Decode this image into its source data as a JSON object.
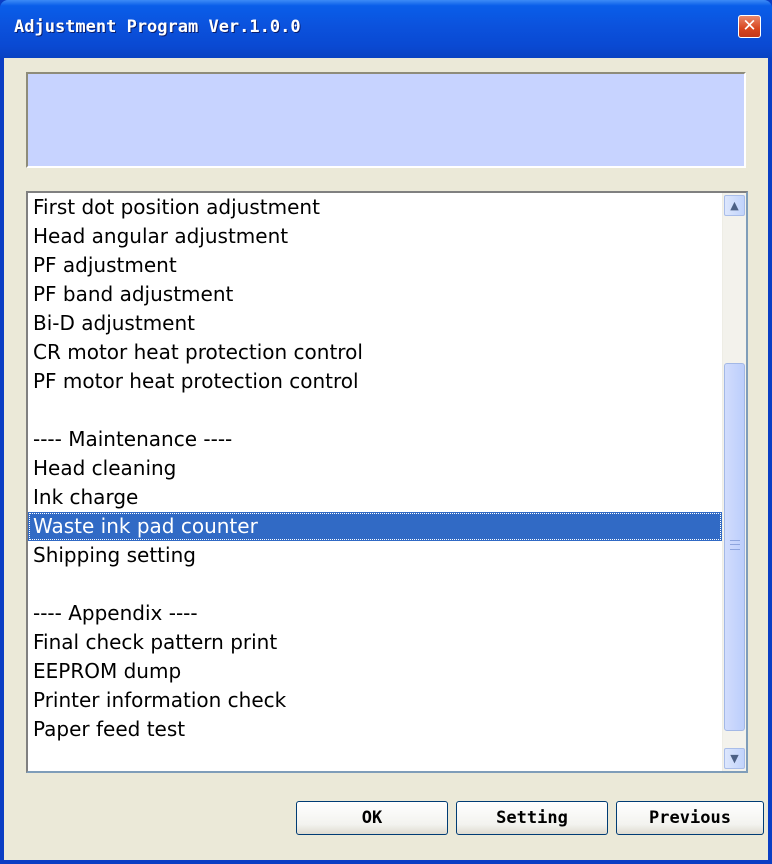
{
  "window": {
    "title": "Adjustment Program Ver.1.0.0",
    "close_glyph": "✕"
  },
  "list": {
    "items": [
      {
        "label": "First dot position adjustment",
        "selected": false
      },
      {
        "label": "Head angular adjustment",
        "selected": false
      },
      {
        "label": "PF adjustment",
        "selected": false
      },
      {
        "label": "PF band adjustment",
        "selected": false
      },
      {
        "label": "Bi-D adjustment",
        "selected": false
      },
      {
        "label": "CR motor heat protection control",
        "selected": false
      },
      {
        "label": "PF motor heat protection control",
        "selected": false
      },
      {
        "label": "",
        "selected": false
      },
      {
        "label": "---- Maintenance ----",
        "selected": false
      },
      {
        "label": "Head cleaning",
        "selected": false
      },
      {
        "label": "Ink charge",
        "selected": false
      },
      {
        "label": "Waste ink pad counter",
        "selected": true
      },
      {
        "label": "Shipping setting",
        "selected": false
      },
      {
        "label": "",
        "selected": false
      },
      {
        "label": "---- Appendix ----",
        "selected": false
      },
      {
        "label": "Final check pattern print",
        "selected": false
      },
      {
        "label": "EEPROM dump",
        "selected": false
      },
      {
        "label": "Printer information check",
        "selected": false
      },
      {
        "label": "Paper feed test",
        "selected": false
      }
    ],
    "scroll_up_glyph": "▲",
    "scroll_down_glyph": "▼"
  },
  "buttons": {
    "ok": "OK",
    "setting": "Setting",
    "previous": "Previous"
  },
  "colors": {
    "title_bar": "#0a52dd",
    "banner": "#c7d3ff",
    "selection": "#316ac5",
    "dialog_bg": "#ebe9d8"
  }
}
